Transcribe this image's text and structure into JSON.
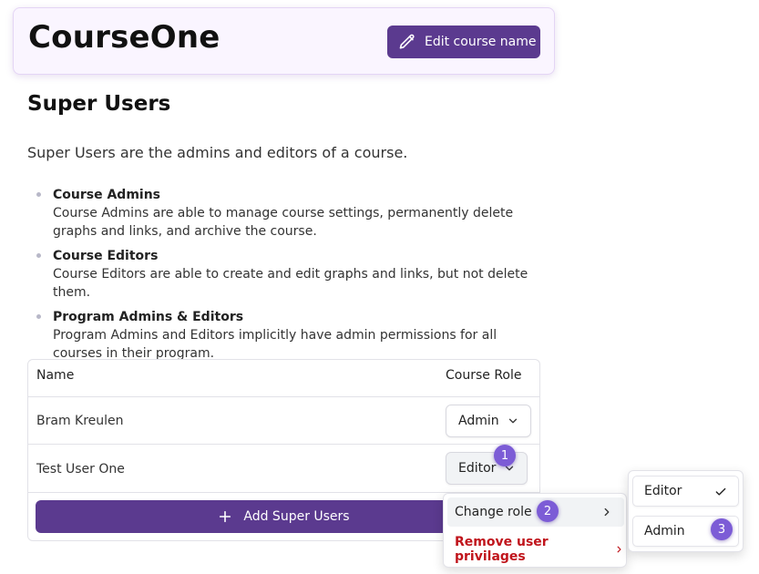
{
  "header": {
    "course_name": "CourseOne",
    "edit_button_label": "Edit course name"
  },
  "section": {
    "title": "Super Users",
    "intro": "Super Users are the admins and editors of a course."
  },
  "roles": [
    {
      "name": "Course Admins",
      "description": "Course Admins are able to manage course settings, permanently delete graphs and links, and archive the course."
    },
    {
      "name": "Course Editors",
      "description": "Course Editors are able to create and edit graphs and links, but not delete them."
    },
    {
      "name": "Program Admins & Editors",
      "description": "Program Admins and Editors implicitly have admin permissions for all courses in their program."
    }
  ],
  "table": {
    "columns": [
      "Name",
      "Course Role"
    ],
    "rows": [
      {
        "name": "Bram Kreulen",
        "role": "Admin"
      },
      {
        "name": "Test User One",
        "role": "Editor"
      }
    ],
    "add_button_label": "Add Super Users"
  },
  "context_menu": {
    "change_role_label": "Change role",
    "remove_label": "Remove user privilages"
  },
  "role_submenu": {
    "options": [
      "Editor",
      "Admin"
    ],
    "selected": "Editor"
  },
  "step_badges": [
    "1",
    "2",
    "3"
  ],
  "colors": {
    "accent": "#5b3a8f",
    "badge": "#7c5cd6",
    "danger": "#c0151c",
    "header_bg": "#faf5ff"
  }
}
